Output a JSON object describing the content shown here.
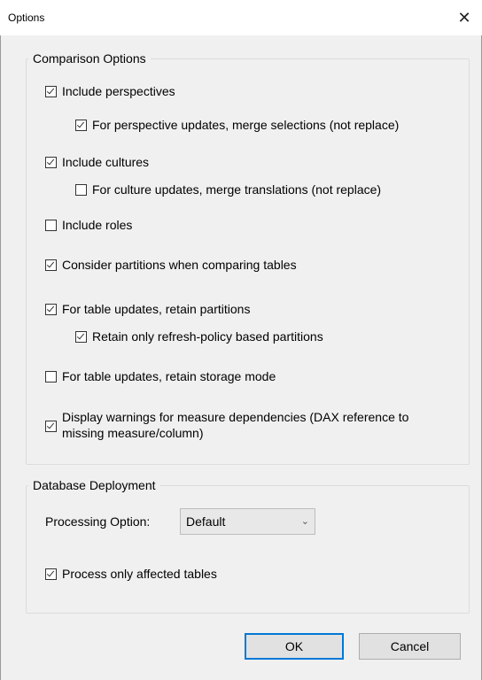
{
  "window": {
    "title": "Options",
    "close_glyph": "✕"
  },
  "comparison": {
    "legend": "Comparison Options",
    "items": [
      {
        "label": "Include perspectives",
        "checked": true
      },
      {
        "label": "For perspective updates, merge selections (not replace)",
        "checked": true
      },
      {
        "label": "Include cultures",
        "checked": true
      },
      {
        "label": "For culture updates, merge translations (not replace)",
        "checked": false
      },
      {
        "label": "Include roles",
        "checked": false
      },
      {
        "label": "Consider partitions when comparing tables",
        "checked": true
      },
      {
        "label": "For table updates, retain partitions",
        "checked": true
      },
      {
        "label": "Retain only refresh-policy based partitions",
        "checked": true
      },
      {
        "label": "For table updates, retain storage mode",
        "checked": false
      },
      {
        "label": "Display warnings for measure dependencies (DAX reference to missing measure/column)",
        "checked": true
      }
    ]
  },
  "deployment": {
    "legend": "Database Deployment",
    "processing_label": "Processing Option:",
    "processing_value": "Default",
    "process_affected": {
      "label": "Process only affected tables",
      "checked": true
    }
  },
  "buttons": {
    "ok": "OK",
    "cancel": "Cancel"
  },
  "colors": {
    "accent": "#0078d7",
    "background": "#f0f0f0"
  }
}
